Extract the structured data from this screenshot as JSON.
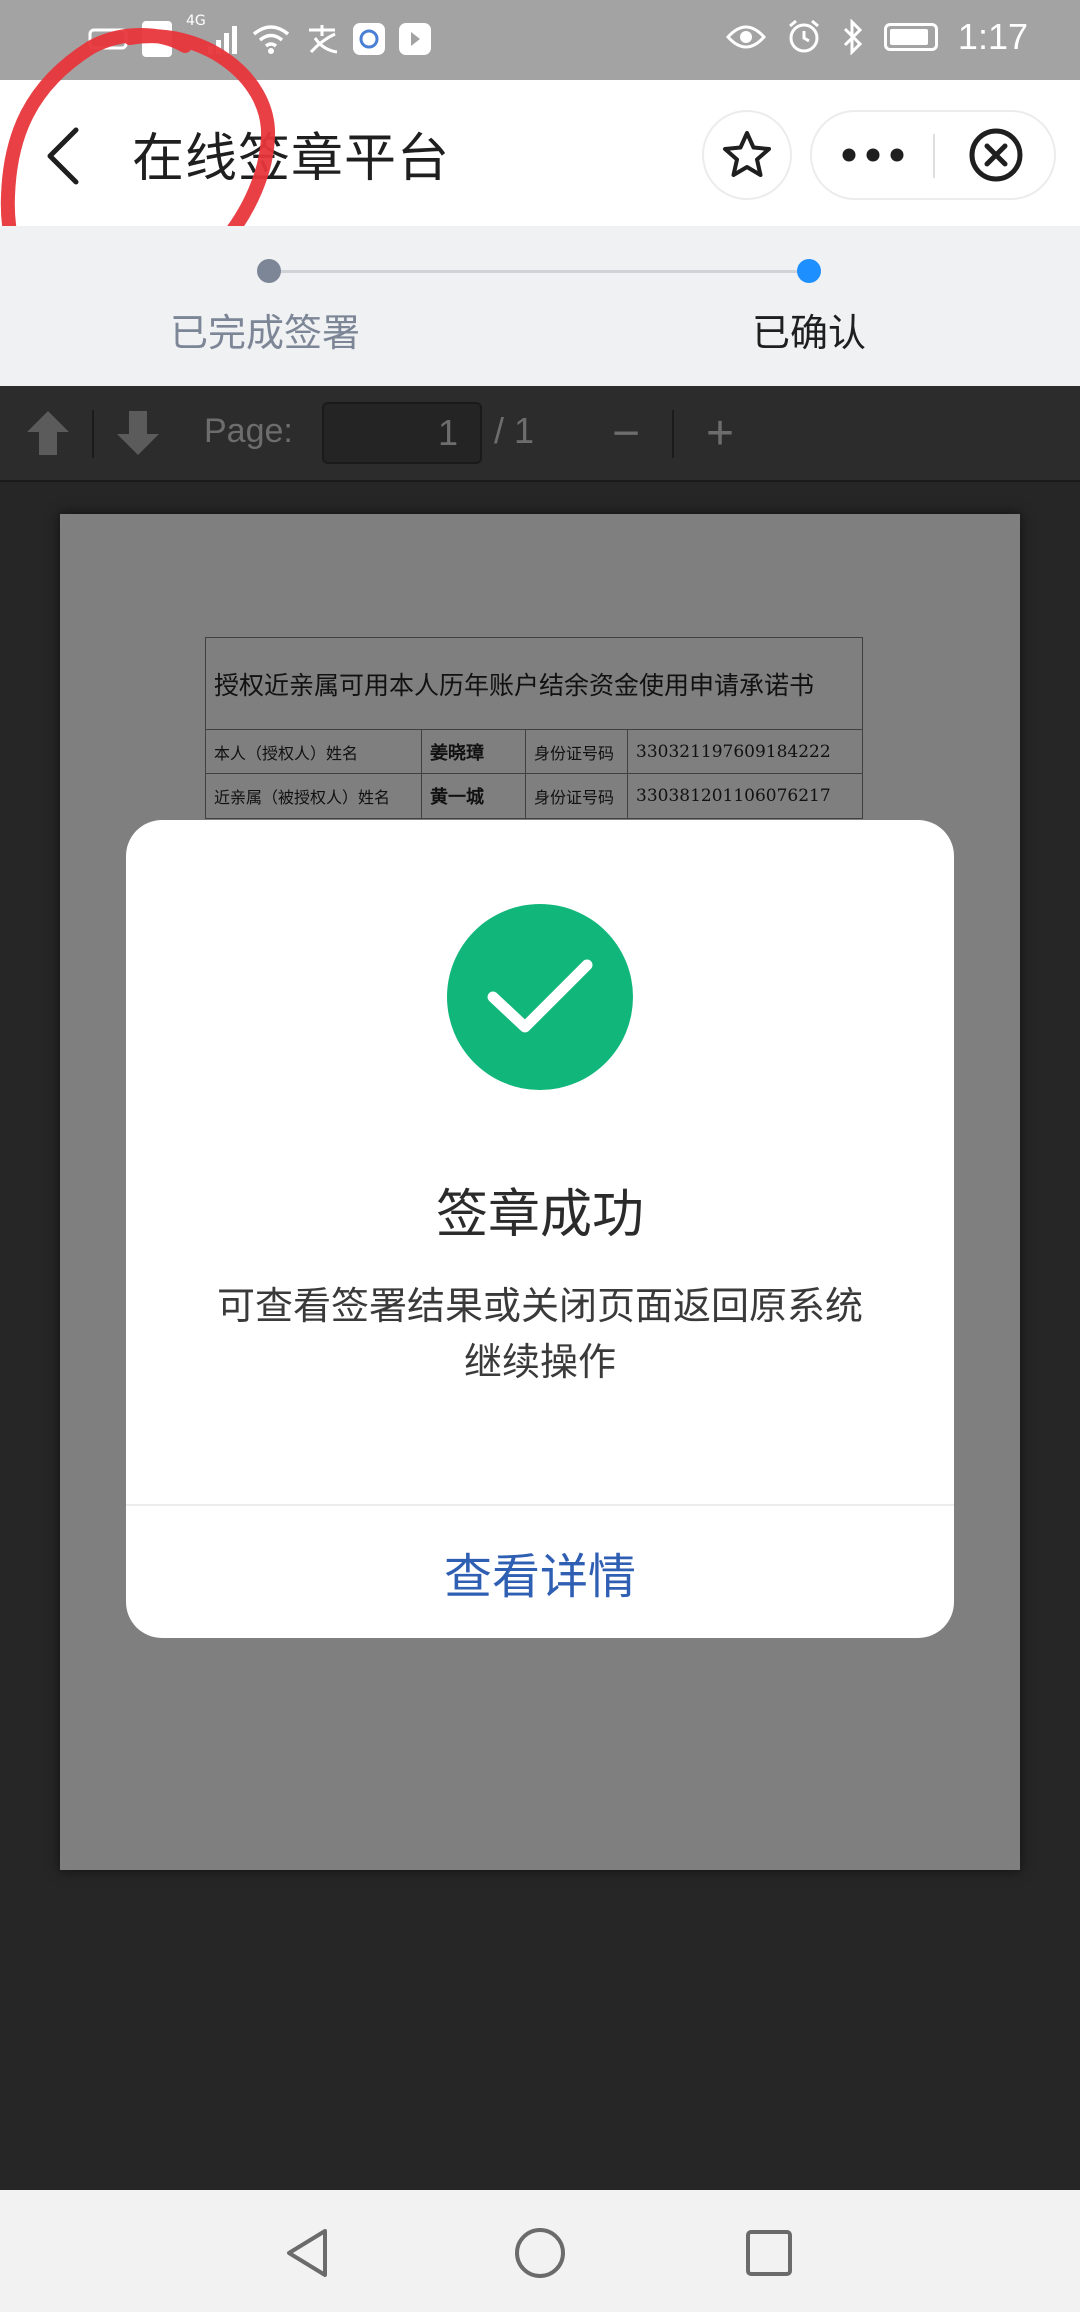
{
  "status_bar": {
    "time": "1:17",
    "left_icons": [
      "carrier-icon",
      "sim-icon",
      "signal-4g-icon",
      "wifi-icon",
      "alipay-icon",
      "app-icon",
      "app-icon"
    ],
    "right_icons": [
      "eye-icon",
      "alarm-icon",
      "bluetooth-icon",
      "battery-icon"
    ],
    "network": "4G"
  },
  "header": {
    "title": "在线签章平台",
    "back_icon": "chevron-left-icon",
    "favorite_icon": "star-icon",
    "more_icon": "more-dots-icon",
    "close_icon": "close-circle-icon"
  },
  "annotation": {
    "color": "#e8363c"
  },
  "steps": [
    {
      "label": "已完成签署",
      "state": "done",
      "color": "#7c8696"
    },
    {
      "label": "已确认",
      "state": "active",
      "color": "#1e8fff"
    }
  ],
  "pdf_toolbar": {
    "prev_icon": "arrow-up-icon",
    "next_icon": "arrow-down-icon",
    "page_label": "Page:",
    "current_page": "1",
    "total_pages": "/ 1",
    "zoom_out": "−",
    "zoom_in": "+"
  },
  "document": {
    "title": "授权近亲属可用本人历年账户结余资金使用申请承诺书",
    "rows": [
      {
        "label": "本人（授权人）姓名",
        "name": "姜晓璋",
        "id_label": "身份证号码",
        "id_number": "330321197609184222"
      },
      {
        "label": "近亲属（被授权人）姓名",
        "name": "黄一城",
        "id_label": "身份证号码",
        "id_number": "330381201106076217"
      }
    ]
  },
  "modal": {
    "icon": "check-circle-icon",
    "icon_color": "#11b77a",
    "title": "签章成功",
    "message": "可查看签署结果或关闭页面返回原系统继续操作",
    "action_label": "查看详情",
    "action_color": "#2f5fb3"
  },
  "nav_bar": {
    "back_icon": "triangle-back-icon",
    "home_icon": "circle-home-icon",
    "recents_icon": "square-recents-icon"
  }
}
